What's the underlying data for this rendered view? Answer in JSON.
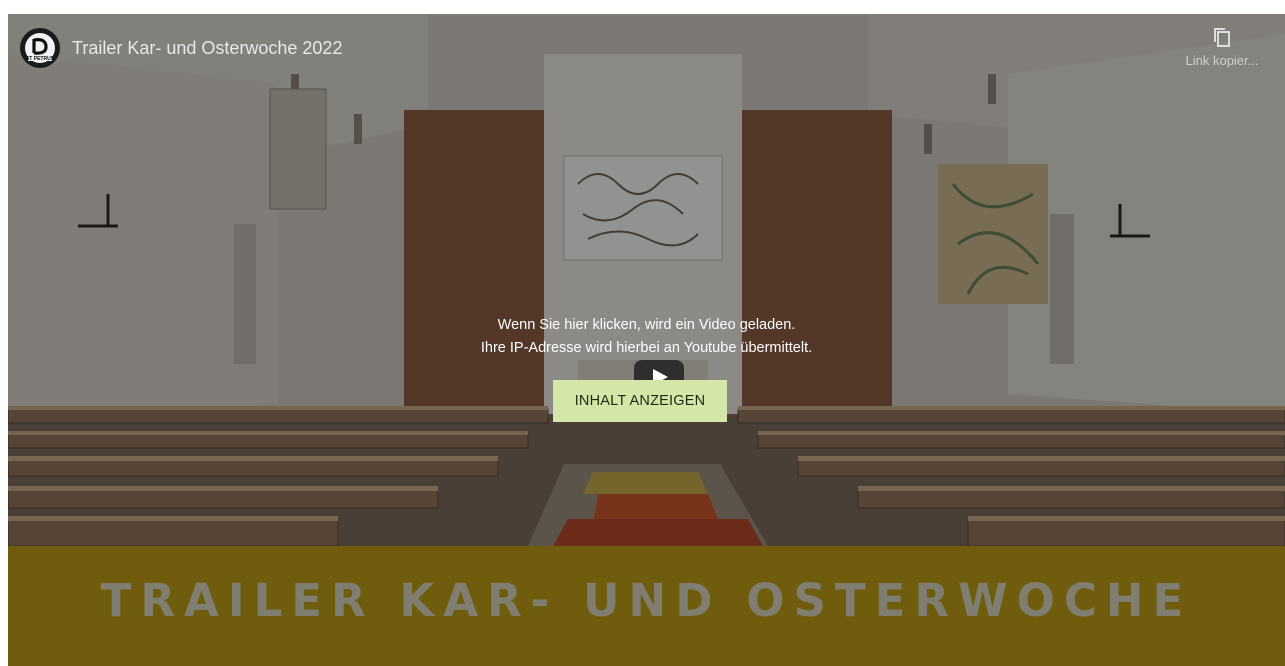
{
  "video": {
    "title": "Trailer Kar- und Osterwoche 2022",
    "channel_logo_icon": "st-petrus-logo-icon",
    "channel_logo_text": "ST PETRUS",
    "copy_link_icon": "copy-icon",
    "copy_link_label": "Link kopier..."
  },
  "consent": {
    "line1": "Wenn Sie hier klicken, wird ein Video geladen.",
    "line2": "Ihre IP-Adresse wird hierbei an Youtube übermittelt.",
    "button_label": "INHALT ANZEIGEN",
    "button_color": "#d4e6a8"
  },
  "thumbnail": {
    "banner_text": "TRAILER KAR- UND OSTERWOCHE",
    "banner_color": "#b99a17"
  },
  "play_icon": "play-icon"
}
